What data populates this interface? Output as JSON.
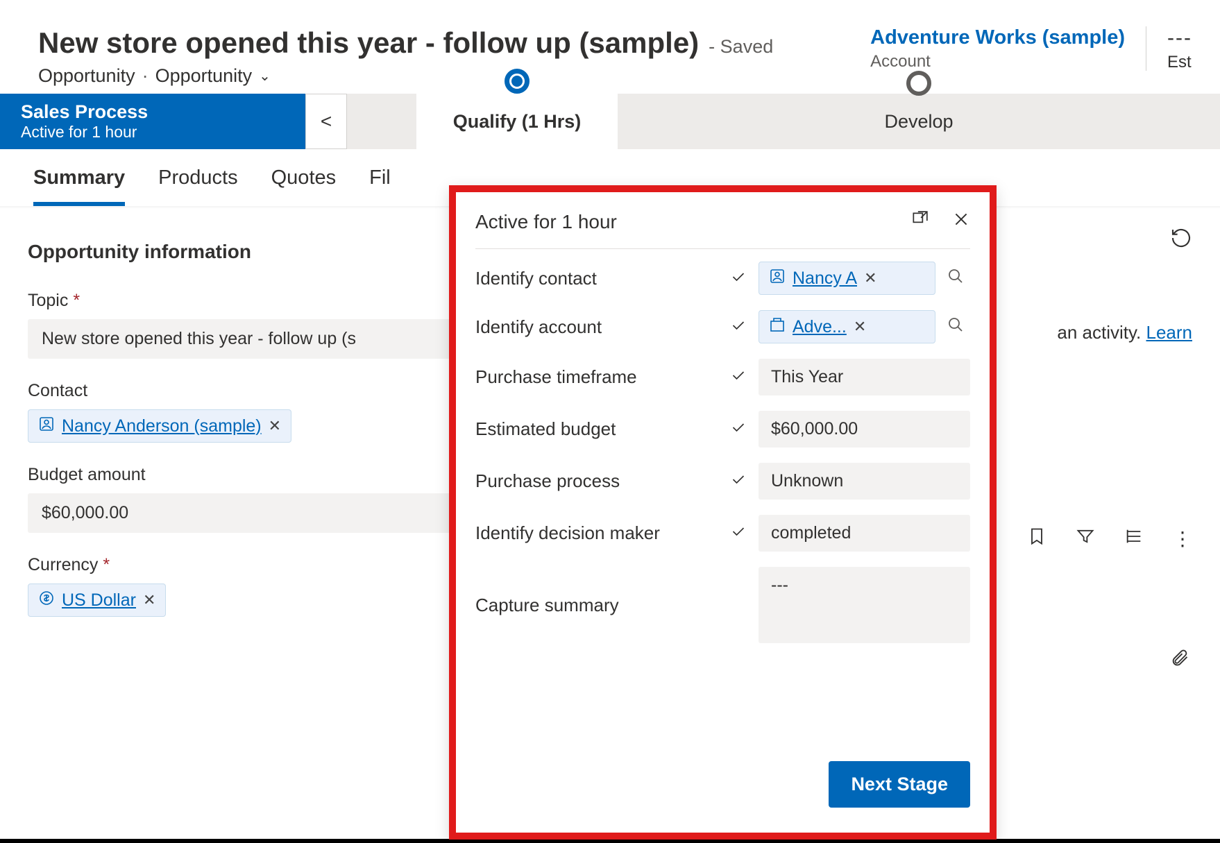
{
  "header": {
    "title": "New store opened this year - follow up (sample)",
    "saved": "- Saved",
    "entity": "Opportunity",
    "form": "Opportunity",
    "account_link": "Adventure Works (sample)",
    "account_label": "Account",
    "est_label": "Est",
    "dots": "---"
  },
  "bpf": {
    "title": "Sales Process",
    "sub": "Active for 1 hour",
    "collapse": "<",
    "stage1": "Qualify  (1 Hrs)",
    "stage2": "Develop"
  },
  "tabs": [
    "Summary",
    "Products",
    "Quotes",
    "Fil"
  ],
  "section": {
    "title": "Opportunity information",
    "topic_label": "Topic",
    "topic_value": "New store opened this year - follow up (s",
    "contact_label": "Contact",
    "contact_value": "Nancy Anderson (sample)",
    "budget_label": "Budget amount",
    "budget_value": "$60,000.00",
    "currency_label": "Currency",
    "currency_value": "US Dollar"
  },
  "flyout": {
    "title": "Active for 1 hour",
    "rows": {
      "r0_label": "Identify contact",
      "r0_link": "Nancy A",
      "r1_label": "Identify account",
      "r1_link": "Adve...",
      "r2_label": "Purchase timeframe",
      "r2_val": "This Year",
      "r3_label": "Estimated budget",
      "r3_val": "$60,000.00",
      "r4_label": "Purchase process",
      "r4_val": "Unknown",
      "r5_label": "Identify decision maker",
      "r5_val": "completed",
      "r6_label": "Capture summary",
      "r6_val": "---"
    },
    "next": "Next Stage"
  },
  "right": {
    "hint_text": "an activity. ",
    "hint_link": "Learn"
  }
}
